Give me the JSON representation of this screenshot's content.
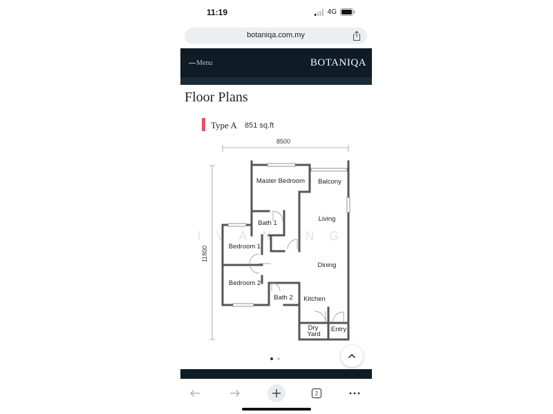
{
  "status_bar": {
    "time": "11:19",
    "network": "4G"
  },
  "browser": {
    "url": "botaniqa.com.my",
    "tab_count": "2"
  },
  "site_header": {
    "menu_label": "Menu",
    "brand": "BOTANIQA"
  },
  "page": {
    "title": "Floor Plans"
  },
  "unit": {
    "type": "Type A",
    "area": "851 sq.ft"
  },
  "floor_plan": {
    "width_dim": "8500",
    "height_dim": "11800",
    "watermark": "IVAN NG",
    "rooms": {
      "master_bedroom": "Master Bedroom",
      "balcony": "Balcony",
      "living": "Living",
      "bath1": "Bath 1",
      "bedroom1": "Bedroom 1",
      "dining": "Dining",
      "bedroom2": "Bedroom 2",
      "bath2": "Bath 2",
      "kitchen": "Kitchen",
      "dry_yard_line1": "Dry",
      "dry_yard_line2": "Yard",
      "entry": "Entry"
    }
  },
  "carousel": {
    "total": 2,
    "active": 0
  },
  "colors": {
    "header_bg": "#0f1b25",
    "accent": "#e4516b",
    "wall": "#555555"
  }
}
